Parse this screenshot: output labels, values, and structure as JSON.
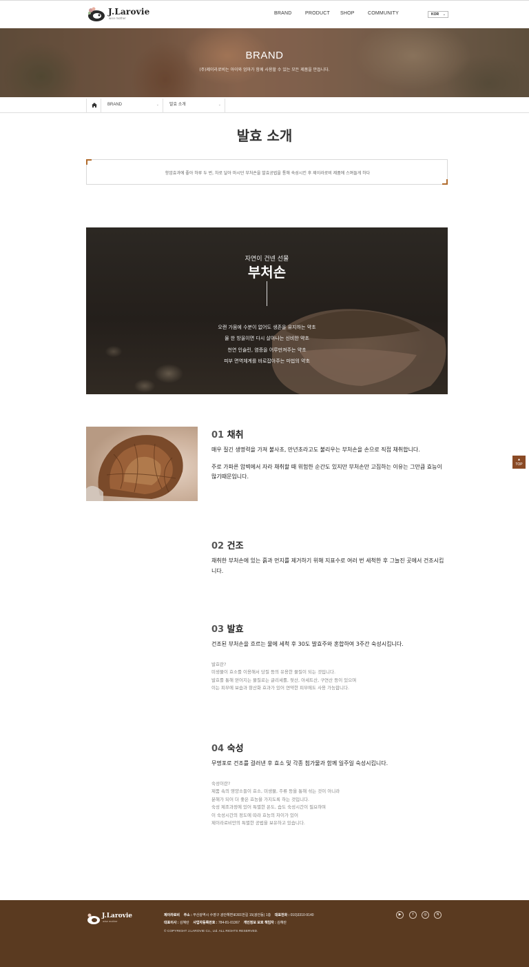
{
  "header": {
    "logo_text": "J.Larovie",
    "logo_sub": "wise mother",
    "nav": [
      "BRAND",
      "PRODUCT",
      "SHOP",
      "COMMUNITY"
    ],
    "lang": "KOR"
  },
  "hero": {
    "title": "BRAND",
    "subtitle": "(주)제이라로비는 아이와 엄마가 함께 사용할 수 있는 모든 제품을 만듭니다."
  },
  "breadcrumb": {
    "level1": "BRAND",
    "level2": "발효 소개"
  },
  "page_title": "발효 소개",
  "quote": "항암효과에 좋아 하루 두 번, 차로 달아 마시던 부처손을 발효공법을 통해 숙성시킨 후 제이라로비 제품에 스며들게 하다",
  "banner": {
    "kicker": "자연이 건넨 선물",
    "title": "부처손",
    "lines": [
      "오랜 가뭄에 수분이 없어도 생존을 유지하는 약초",
      "물 한 방울이면 다시 살아나는 신비한 약초",
      "천연 인슐린, 염증을 어루만져주는 약초",
      "피부 면역체계를 바로잡아주는 마법의 약초"
    ]
  },
  "steps": [
    {
      "num": "01",
      "title": "채취",
      "paragraphs": [
        "매우 질긴 생명력을 가져 불사초, 만년초라고도 불리우는 부처손을 손으로 직접 채취합니다.",
        "주로 가파른 암벽에서 자라 채취할 때 위험한 순간도 있지만 부처손만 고집하는 이유는 그만큼 효능이 많기때문입니다."
      ]
    },
    {
      "num": "02",
      "title": "건조",
      "paragraphs": [
        "채취한 부처손에 있는 흙과 먼지를 제거하기 위해 지표수로 여러 번 세척한 후 그늘진 곳에서 건조시킵니다."
      ]
    },
    {
      "num": "03",
      "title": "발효",
      "paragraphs": [
        "건조된 부처손을 흐르는 물에 세척 후 30도 발효주와 혼합하여 3주간 숙성시킵니다."
      ],
      "note": [
        "발효란?",
        "미생물이 효소를 이용해서 당질 등의 유용한 물질이 되는 것입니다.",
        "발효를 통해 얻어지는 물질로는 글리세롤, 젖산, 아세트산, 구연산 등이 있으며",
        "이는 피부에 보습과 항산화 효과가 있어 연약한 피부에도 사용 가능합니다."
      ]
    },
    {
      "num": "04",
      "title": "숙성",
      "paragraphs": [
        "무명포로 건조를 걸러낸 후 효소 및 각종 첨가물과 함께 일주일 숙성시킵니다."
      ],
      "note": [
        "숙성이란?",
        "제품 속의 영양소들이 효소, 미생물, 주류 등을 통해 섞는 것이 아니라",
        "분해가 되어 더 좋은 효능을 가지도록 하는 것입니다.",
        "숙성 제조과정에 있어 특별한 온도, 습도 숙성시간이 필요하며",
        "이 숙성시간의 정도에 따라 효능의 차이가 있어",
        "제이라로비만의 특별한 공법을 보유하고 있습니다."
      ]
    }
  ],
  "top_button": "TOP",
  "footer": {
    "logo_text": "J.Larovie",
    "logo_sub": "wise mother",
    "company": "제이라로비",
    "address_label": "주소 :",
    "address": "부산광역시 수영구 광안해변로301번길 15(광안동) 1층",
    "phone_label": "대표전화 :",
    "phone": "010)3310-9140",
    "ceo_label": "대표이사 :",
    "ceo": "김혜란",
    "bizno_label": "사업자등록번호 :",
    "bizno": "784-81-01367",
    "privacy_label": "개인정보 보호 책임자 :",
    "privacy": "김혜란",
    "copyright": "© COPYRIGHT J.LAROVIE Co., Ltd. ALL RIGHTS RESERVED.",
    "sns": [
      "youtube-icon",
      "facebook-icon",
      "instagram-icon",
      "naver-blog-icon"
    ]
  },
  "colors": {
    "accent": "#b06a2a",
    "footer_bg": "#5a3a20",
    "top_button": "#8a4a25"
  }
}
